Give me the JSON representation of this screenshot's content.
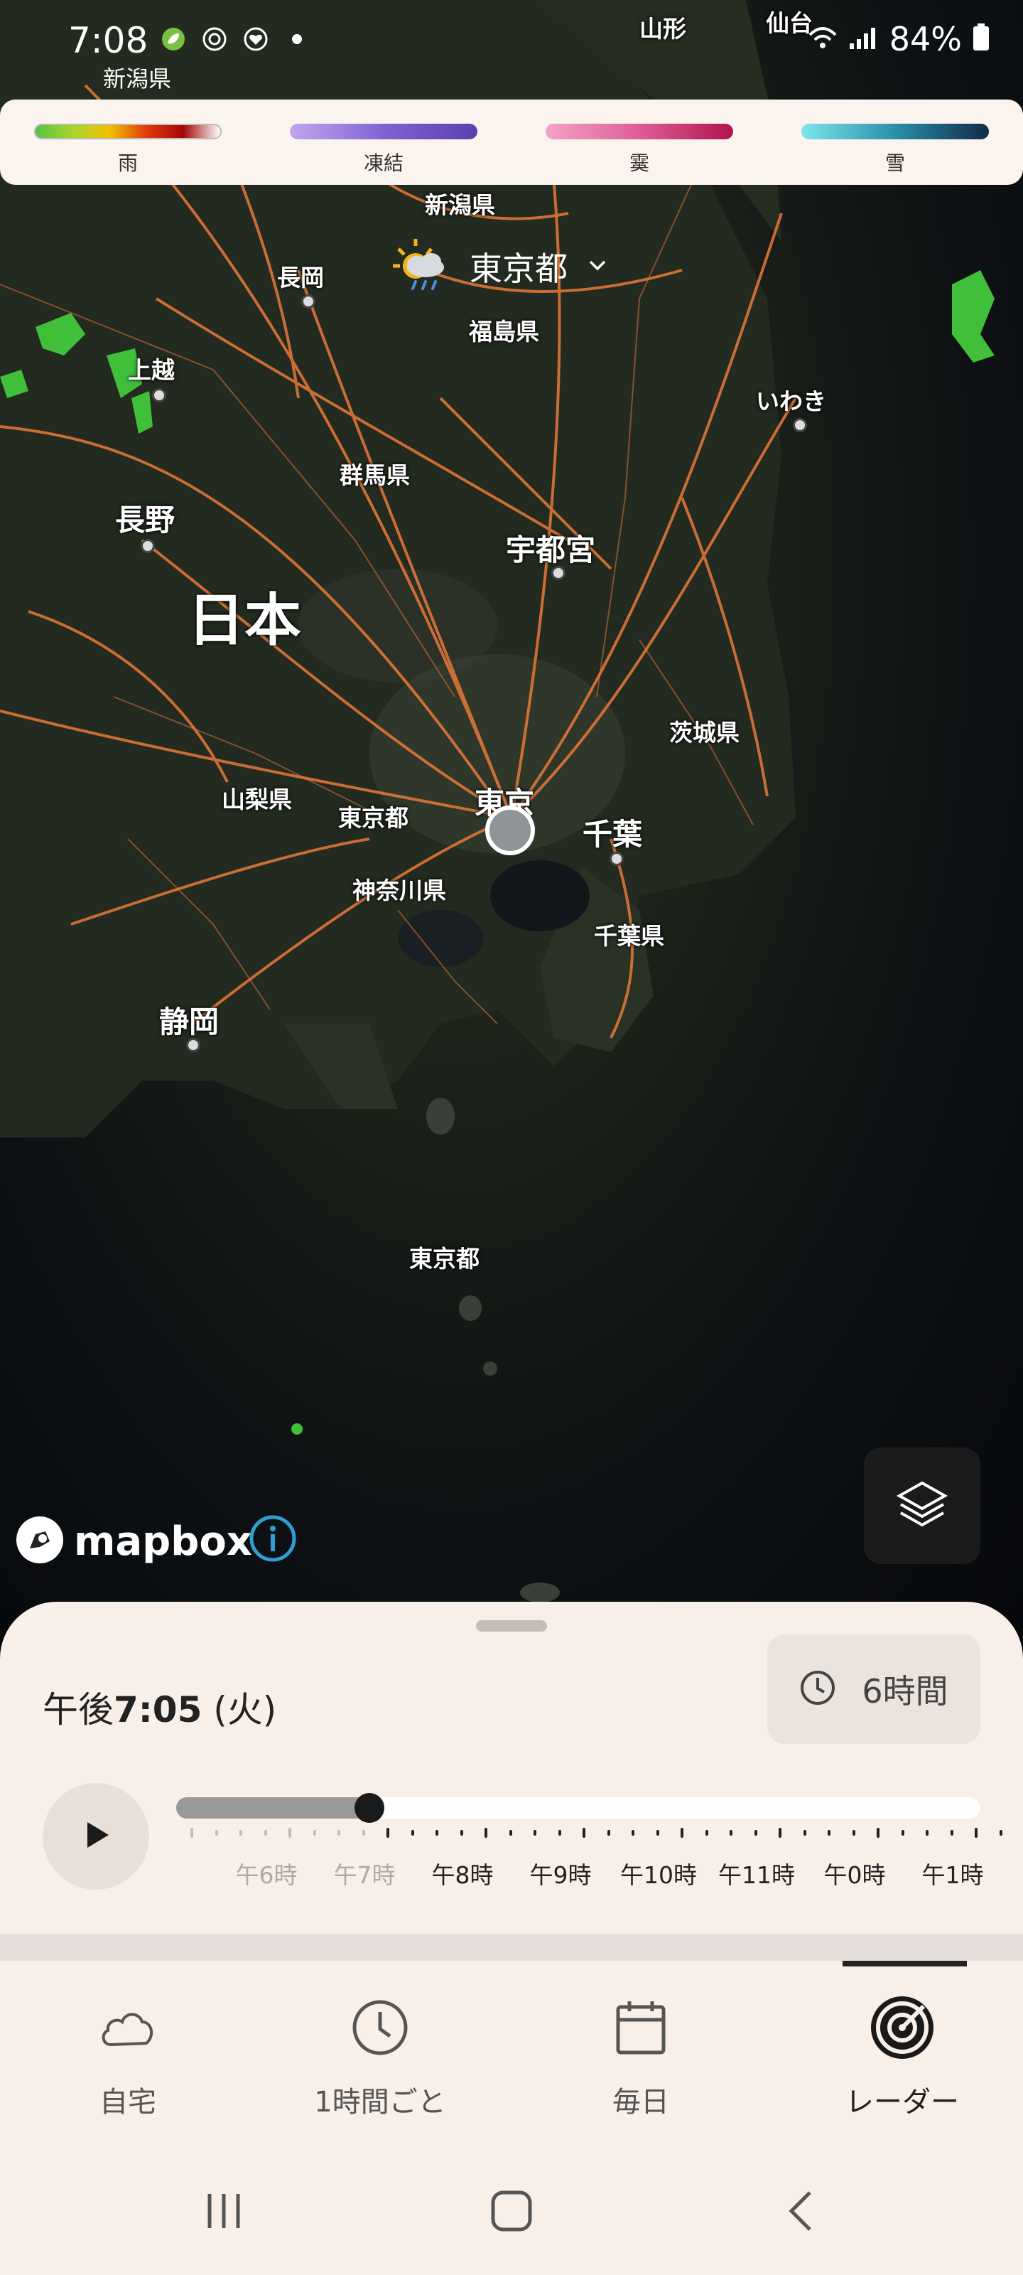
{
  "status_bar": {
    "time": "7:08",
    "sublabel": "新潟県",
    "battery": "84%",
    "icons": [
      "leaf-app-icon",
      "focus-icon",
      "heart-app-icon",
      "dot-icon",
      "wifi-icon",
      "signal-icon",
      "battery-icon"
    ]
  },
  "legend": [
    {
      "label": "雨",
      "gradient": "linear-gradient(90deg,#58c246,#a7d62e,#f3c100,#e13b0a,#a30808,#fff)"
    },
    {
      "label": "凍結",
      "gradient": "linear-gradient(90deg,#c2a6ef,#8262d2,#5c3fae)"
    },
    {
      "label": "霙",
      "gradient": "linear-gradient(90deg,#f3a3c8,#de5d97,#b1134d)"
    },
    {
      "label": "雪",
      "gradient": "linear-gradient(90deg,#7ee6ed,#2b8fa8,#0f2a48)"
    }
  ],
  "place_selector": {
    "name": "東京都",
    "icon": "partly-cloudy-rain-icon"
  },
  "map_labels": [
    {
      "key": "yamagata",
      "text": "山形"
    },
    {
      "key": "sendai",
      "text": "仙台"
    },
    {
      "key": "niigata",
      "text": "新潟県"
    },
    {
      "key": "nagaoka",
      "text": "長岡"
    },
    {
      "key": "fukushima",
      "text": "福島県"
    },
    {
      "key": "joetsu",
      "text": "上越"
    },
    {
      "key": "iwaki",
      "text": "いわき"
    },
    {
      "key": "gunma",
      "text": "群馬県"
    },
    {
      "key": "nagano",
      "text": "長野"
    },
    {
      "key": "utsunomiya",
      "text": "宇都宮"
    },
    {
      "key": "nihon",
      "text": "日本"
    },
    {
      "key": "ibaraki",
      "text": "茨城県"
    },
    {
      "key": "yamanashi",
      "text": "山梨県"
    },
    {
      "key": "tokyo_pref",
      "text": "東京都"
    },
    {
      "key": "tokyo_city",
      "text": "東京"
    },
    {
      "key": "chiba_city",
      "text": "千葉"
    },
    {
      "key": "kanagawa",
      "text": "神奈川県"
    },
    {
      "key": "chiba_pref",
      "text": "千葉県"
    },
    {
      "key": "shizuoka",
      "text": "静岡"
    },
    {
      "key": "tokyo_islands",
      "text": "東京都"
    }
  ],
  "mapbox": {
    "text": "mapbox"
  },
  "timeline": {
    "time_prefix": "午後",
    "time": "7:05",
    "day": "(火)",
    "duration": "6時間",
    "progress": 0.24,
    "hours": [
      {
        "label": "午6時",
        "state": "past"
      },
      {
        "label": "午7時",
        "state": "past"
      },
      {
        "label": "午8時",
        "state": "future"
      },
      {
        "label": "午9時",
        "state": "future"
      },
      {
        "label": "午10時",
        "state": "future"
      },
      {
        "label": "午11時",
        "state": "future"
      },
      {
        "label": "午0時",
        "state": "future"
      },
      {
        "label": "午1時",
        "state": "future"
      }
    ]
  },
  "nav": [
    {
      "label": "自宅",
      "icon": "cloud-icon",
      "active": false
    },
    {
      "label": "1時間ごと",
      "icon": "clock-icon",
      "active": false
    },
    {
      "label": "毎日",
      "icon": "calendar-icon",
      "active": false
    },
    {
      "label": "レーダー",
      "icon": "radar-icon",
      "active": true
    }
  ]
}
